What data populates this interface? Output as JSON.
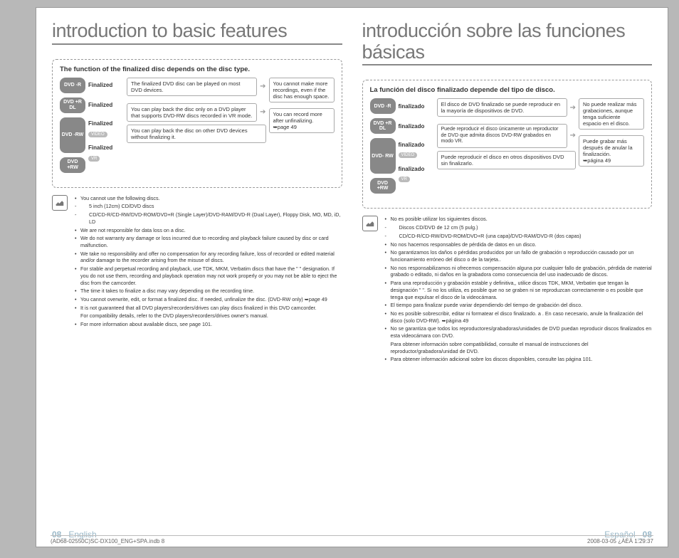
{
  "left": {
    "heading": "introduction to basic features",
    "box_title": "The function of the finalized disc depends on the disc type.",
    "discs": {
      "r": "DVD\n-R",
      "rdl": "DVD\n+R DL",
      "rw": "DVD\n-RW",
      "prw": "DVD\n+RW"
    },
    "fin": "Finalized",
    "tags": {
      "video": "VIDEO",
      "vr": "VR"
    },
    "info1": "The finalized DVD disc can be played on most DVD devices.",
    "info2": "You can play back the disc only on a DVD player that supports DVD-RW discs recorded in VR mode.",
    "info3": "You can play back the disc on other DVD devices without finalizing it.",
    "side1": "You cannot make more recordings, even if the disc has enough space.",
    "side2": "You can record more after unfinalizing.",
    "side2_ref": "➥page 49",
    "notes": [
      "You cannot use the following discs.",
      "5 inch (12cm) CD/DVD discs",
      "CD/CD-R/CD-RW/DVD-ROM/DVD+R (Single Layer)/DVD-RAM/DVD-R (Dual Layer), Floppy Disk, MO, MD, iD, LD",
      "We are not responsible for data loss on a disc.",
      "We do not warranty any damage or loss incurred due to recording and playback failure caused by disc or card malfunction.",
      "We take no responsibility and offer no compensation for any recording failure, loss of recorded or edited material and/or damage to the recorder arising from the misuse of discs.",
      "For stable and perpetual recording and playback, use TDK, MKM, Verbatim discs that have the \"        \" designation. If you do not use them, recording and playback operation may not work properly or you may not be able to eject the disc from the camcorder.",
      "The time it takes to finalize a disc may vary depending on the recording time.",
      "You cannot overwrite, edit, or format a finalized disc. If needed, unfinalize the disc. (DVD-RW only) ➥page 49",
      "It is not guaranteed that all DVD players/recorders/drives can play discs finalized in this DVD camcorder.",
      "For compatibility details, refer to the DVD players/recorders/drives owner's manual.",
      "For more information about available discs, see page 101."
    ],
    "page_label_a": "08_",
    "page_label_b": " English"
  },
  "right": {
    "heading": "introducción sobre las funciones básicas",
    "box_title": "La función del disco finalizado depende del tipo de disco.",
    "discs": {
      "r": "DVD\n-R",
      "rdl": "DVD\n+R DL",
      "rw": "DVD-\nRW",
      "prw": "DVD\n+RW"
    },
    "fin": "finalizado",
    "tags": {
      "video": "VIDEO",
      "vr": "VR"
    },
    "info1": "El disco de DVD finalizado se puede reproducir en la mayoría de dispositivos de DVD.",
    "info2": "Puede reproducir el disco únicamente un reproductor de DVD que admita discos DVD-RW grabados en modo VR.",
    "info3": "Puede reproducir el disco en otros dispositivos DVD sin finalizarlo.",
    "side1": "No puede realizar más grabaciones, aunque tenga suficiente espacio en el disco.",
    "side2": "Puede grabar más después de anular la finalización.",
    "side2_ref": "➥página 49",
    "notes": [
      "No es posible utilizar los siguientes discos.",
      "Discos CD/DVD de 12 cm (5 pulg.)",
      "CD/CD-R/CD-RW/DVD-ROM/DVD+R (una capa)/DVD-RAM/DVD-R (dos capas)",
      "No nos hacemos responsables de pérdida de datos en un disco.",
      "No garantizamos los daños o pérdidas producidos por un fallo de grabación o reproducción causado por un funcionamiento erróneo del disco o de la tarjeta..",
      "No nos responsabilizamos ni ofrecemos compensación alguna por cualquier fallo de grabación, pérdida de material grabado o editado, ni daños en la grabadora como consecuencia del uso inadecuado de discos.",
      "Para una reproducción y grabación estable y definitiva,, utilice discos TDK, MKM, Verbatim  que tengan la designación \"        \". Si no los utiliza, es posible que no se graben ni se reproduzcan correctamente o es posible que tenga que expulsar el disco de la videocámara.",
      "El tiempo para finalizar puede variar dependiendo del tiempo de grabación del disco.",
      "No es posible sobrescribir, editar ni formatear el disco finalizado. a . En caso necesario, anule la finalización del disco (solo DVD-RW). ➥página 49",
      "No se garantiza que todos los reproductores/grabadoras/unidades de DVD puedan reproducir discos finalizados en esta  videocámara con DVD.",
      "Para obtener información sobre compatibilidad, consulte el manual de instrucciones del reproductor/grabadora/unidad de DVD.",
      "Para obtener información adicional sobre los discos disponibles, consulte las página 101."
    ],
    "page_label_a": "Español _",
    "page_label_b": "08"
  },
  "footer": {
    "file": "(AD68-02550C)SC-DX100_ENG+SPA.indb   8",
    "ts": "2008-03-05   ¿ÀÈÄ 1:29:37"
  }
}
